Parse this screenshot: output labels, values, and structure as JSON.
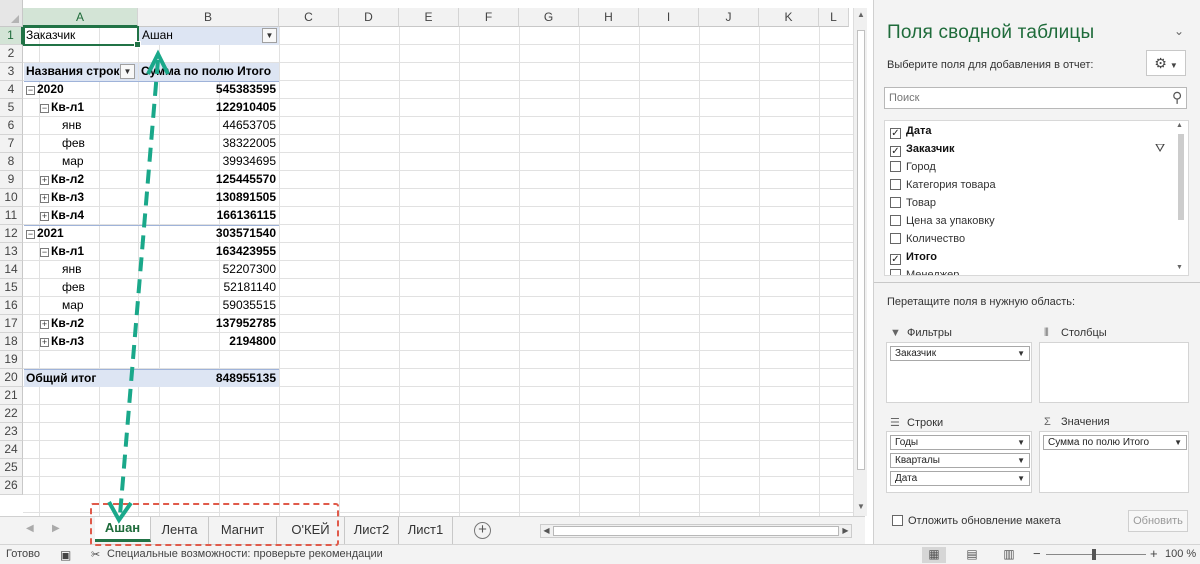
{
  "sheet": {
    "columns": [
      "A",
      "B",
      "C",
      "D",
      "E",
      "F",
      "G",
      "H",
      "I",
      "J",
      "K",
      "L"
    ],
    "rows": [
      "1",
      "2",
      "3",
      "4",
      "5",
      "6",
      "7",
      "8",
      "9",
      "10",
      "11",
      "12",
      "13",
      "14",
      "15",
      "16",
      "17",
      "18",
      "19",
      "20",
      "21",
      "22",
      "23",
      "24",
      "25",
      "26"
    ],
    "filter_label": "Заказчик",
    "filter_value": "Ашан",
    "row_labels_header": "Названия строк",
    "sum_header": "Сумма по полю Итого",
    "pivot_rows": [
      {
        "label": "2020",
        "value": "545383595",
        "level": 0,
        "bold": true,
        "toggle": "−"
      },
      {
        "label": "Кв-л1",
        "value": "122910405",
        "level": 1,
        "bold": true,
        "toggle": "−"
      },
      {
        "label": "янв",
        "value": "44653705",
        "level": 2,
        "bold": false,
        "toggle": ""
      },
      {
        "label": "фев",
        "value": "38322005",
        "level": 2,
        "bold": false,
        "toggle": ""
      },
      {
        "label": "мар",
        "value": "39934695",
        "level": 2,
        "bold": false,
        "toggle": ""
      },
      {
        "label": "Кв-л2",
        "value": "125445570",
        "level": 1,
        "bold": true,
        "toggle": "+"
      },
      {
        "label": "Кв-л3",
        "value": "130891505",
        "level": 1,
        "bold": true,
        "toggle": "+"
      },
      {
        "label": "Кв-л4",
        "value": "166136115",
        "level": 1,
        "bold": true,
        "toggle": "+"
      },
      {
        "label": "2021",
        "value": "303571540",
        "level": 0,
        "bold": true,
        "toggle": "−"
      },
      {
        "label": "Кв-л1",
        "value": "163423955",
        "level": 1,
        "bold": true,
        "toggle": "−"
      },
      {
        "label": "янв",
        "value": "52207300",
        "level": 2,
        "bold": false,
        "toggle": ""
      },
      {
        "label": "фев",
        "value": "52181140",
        "level": 2,
        "bold": false,
        "toggle": ""
      },
      {
        "label": "мар",
        "value": "59035515",
        "level": 2,
        "bold": false,
        "toggle": ""
      },
      {
        "label": "Кв-л2",
        "value": "137952785",
        "level": 1,
        "bold": true,
        "toggle": "+"
      },
      {
        "label": "Кв-л3",
        "value": "2194800",
        "level": 1,
        "bold": true,
        "toggle": "+"
      }
    ],
    "grand_total_label": "Общий итог",
    "grand_total_value": "848955135"
  },
  "tabs": {
    "items": [
      "Ашан",
      "Лента",
      "Магнит",
      "О'КЕЙ",
      "Лист2",
      "Лист1"
    ],
    "active": "Ашан"
  },
  "status": {
    "ready": "Готово",
    "accessibility": "Специальные возможности: проверьте рекомендации",
    "zoom": "100 %"
  },
  "pane": {
    "title": "Поля сводной таблицы",
    "subtitle": "Выберите поля для добавления в отчет:",
    "search_placeholder": "Поиск",
    "fields": [
      {
        "label": "Дата",
        "checked": true
      },
      {
        "label": "Заказчик",
        "checked": true
      },
      {
        "label": "Город",
        "checked": false
      },
      {
        "label": "Категория товара",
        "checked": false
      },
      {
        "label": "Товар",
        "checked": false
      },
      {
        "label": "Цена за упаковку",
        "checked": false
      },
      {
        "label": "Количество",
        "checked": false
      },
      {
        "label": "Итого",
        "checked": true
      },
      {
        "label": "Менеджер",
        "checked": false
      }
    ],
    "drag_label": "Перетащите поля в нужную область:",
    "areas": {
      "filters_title": "Фильтры",
      "columns_title": "Столбцы",
      "rows_title": "Строки",
      "values_title": "Значения",
      "filters": [
        "Заказчик"
      ],
      "rows": [
        "Годы",
        "Кварталы",
        "Дата"
      ],
      "values": [
        "Сумма по полю Итого"
      ]
    },
    "defer_label": "Отложить обновление макета",
    "update_label": "Обновить"
  },
  "colors": {
    "excel_green": "#217346",
    "pivot_header_blue": "#dde5f3",
    "annotation_teal": "#1aa88a",
    "annotation_red": "#e05a4a"
  }
}
